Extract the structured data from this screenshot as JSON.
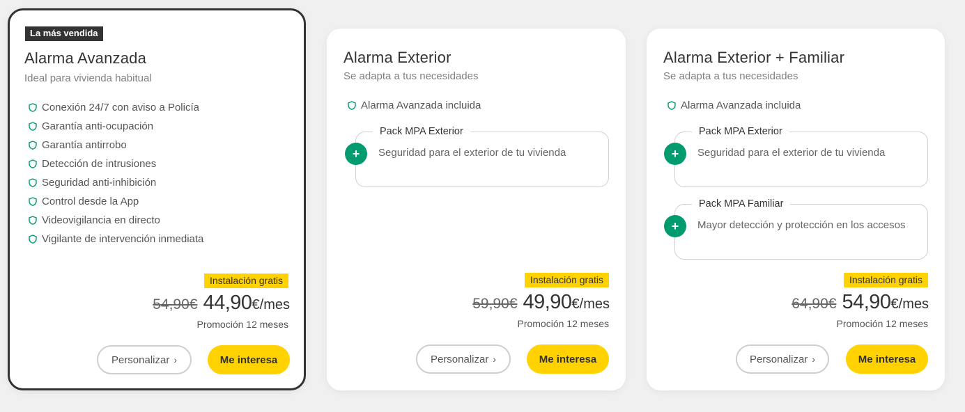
{
  "colors": {
    "background": "#f0f0f0",
    "card": "#ffffff",
    "accent_yellow": "#ffd200",
    "accent_green": "#009b6e",
    "dark": "#333333"
  },
  "plans": [
    {
      "badge": "La más vendida",
      "title": "Alarma Avanzada",
      "subtitle": "Ideal para vivienda habitual",
      "features": [
        "Conexión 24/7 con aviso a Policía",
        "Garantía anti-ocupación",
        "Garantía antirrobo",
        "Detección de intrusiones",
        "Seguridad anti-inhibición",
        "Control desde la App",
        "Videovigilancia en directo",
        "Vigilante de intervención inmediata"
      ],
      "promo_label": "Instalación gratis",
      "old_price": "54,90€",
      "new_price": "44,90",
      "unit": "€/mes",
      "promo_note": "Promoción 12 meses",
      "customize_label": "Personalizar",
      "cta_label": "Me interesa"
    },
    {
      "title": "Alarma Exterior",
      "subtitle": "Se adapta a tus necesidades",
      "features": [
        "Alarma Avanzada incluida"
      ],
      "packs": [
        {
          "title": "Pack MPA Exterior",
          "description": "Seguridad para el exterior de tu vivienda",
          "icon": "plus-icon"
        }
      ],
      "promo_label": "Instalación gratis",
      "old_price": "59,90€",
      "new_price": "49,90",
      "unit": "€/mes",
      "promo_note": "Promoción 12 meses",
      "customize_label": "Personalizar",
      "cta_label": "Me interesa"
    },
    {
      "title": "Alarma Exterior + Familiar",
      "subtitle": "Se adapta a tus necesidades",
      "features": [
        "Alarma Avanzada incluida"
      ],
      "packs": [
        {
          "title": "Pack MPA Exterior",
          "description": "Seguridad para el exterior de tu vivienda",
          "icon": "plus-icon"
        },
        {
          "title": "Pack MPA Familiar",
          "description": "Mayor detección y protección en los accesos",
          "icon": "plus-icon"
        }
      ],
      "promo_label": "Instalación gratis",
      "old_price": "64,90€",
      "new_price": "54,90",
      "unit": "€/mes",
      "promo_note": "Promoción 12 meses",
      "customize_label": "Personalizar",
      "cta_label": "Me interesa"
    }
  ]
}
